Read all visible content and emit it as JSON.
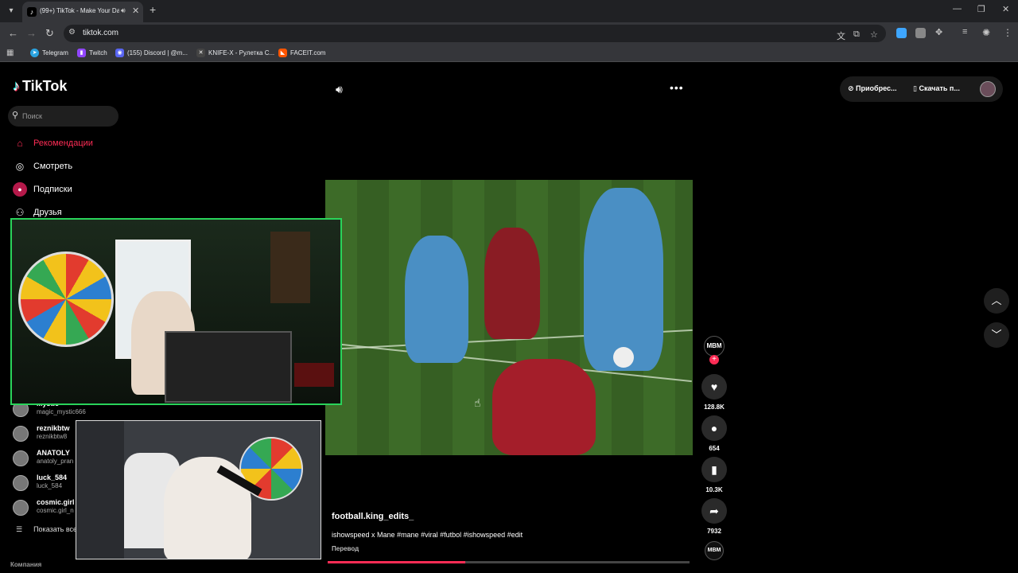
{
  "browser": {
    "tab_title": "(99+) TikTok - Make Your Day",
    "url": "tiktok.com",
    "bookmarks": [
      {
        "label": "Telegram",
        "color": "#2aa3e0"
      },
      {
        "label": "Twitch",
        "color": "#9146ff"
      },
      {
        "label": "(155) Discord | @m...",
        "color": "#5865f2"
      },
      {
        "label": "KNIFE-X - Рулетка С...",
        "color": "#444444"
      },
      {
        "label": "FACEIT.com",
        "color": "#ff5500"
      }
    ]
  },
  "tiktok": {
    "logo": "TikTok",
    "search_placeholder": "Поиск",
    "nav": [
      {
        "label": "Рекомендации",
        "icon": "home-icon",
        "active": true
      },
      {
        "label": "Смотреть",
        "icon": "compass-icon"
      },
      {
        "label": "Подписки",
        "icon": "following-icon"
      },
      {
        "label": "Друзья",
        "icon": "friends-icon"
      }
    ],
    "accounts": [
      {
        "name": "Mystic",
        "handle": "magic_mystic666"
      },
      {
        "name": "reznikbtw",
        "handle": "reznikbtw8"
      },
      {
        "name": "ANATOLY",
        "handle": "anatoly_pran"
      },
      {
        "name": "luck_584",
        "handle": "luck_584"
      },
      {
        "name": "cosmic.girl",
        "handle": "cosmic.girl_n"
      }
    ],
    "show_more": "Показать все",
    "company": "Компания",
    "top_buttons": {
      "get_coins": "Приобрес...",
      "download": "Скачать п..."
    },
    "video": {
      "author": "football.king_edits_",
      "description": "ishowspeed x Mane #mane  #viral #futbol #ishowspeed #edit",
      "translate": "Перевод",
      "progress": 0.38
    },
    "actions": {
      "creator_badge": "MBM",
      "likes": "128.8K",
      "comments": "654",
      "saves": "10.3K",
      "shares": "7932"
    },
    "accent": "#fe2c55"
  }
}
